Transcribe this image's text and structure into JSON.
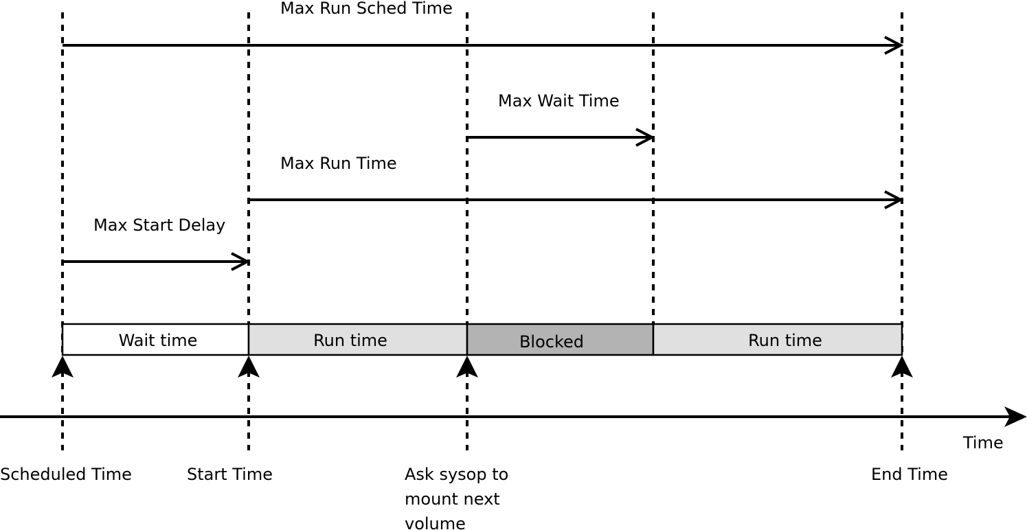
{
  "diagram": {
    "events": [
      {
        "label_lines": [
          "Scheduled Time"
        ]
      },
      {
        "label_lines": [
          "Start Time"
        ]
      },
      {
        "label_lines": [
          "Ask sysop to",
          "mount next",
          "volume"
        ]
      },
      {
        "label_lines": []
      },
      {
        "label_lines": [
          "End Time"
        ]
      }
    ],
    "intervals": [
      {
        "label": "Max Run Sched Time"
      },
      {
        "label": "Max Wait Time"
      },
      {
        "label": "Max Run Time"
      },
      {
        "label": "Max Start Delay"
      }
    ],
    "segments": [
      {
        "label": "Wait time",
        "color": "#ffffff"
      },
      {
        "label": "Run time",
        "color": "#e0e0e0"
      },
      {
        "label": "Blocked",
        "color": "#b3b3b3"
      },
      {
        "label": "Run time",
        "color": "#e0e0e0"
      }
    ],
    "axis_label": "Time"
  }
}
